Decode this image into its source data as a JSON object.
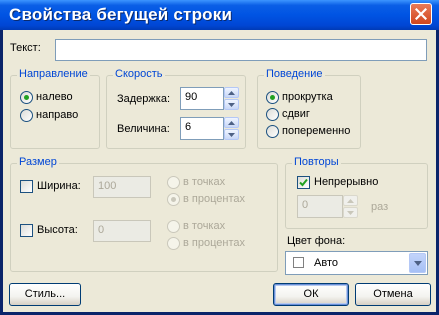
{
  "window": {
    "title": "Свойства бегущей строки"
  },
  "text_field": {
    "label": "Текст:",
    "value": ""
  },
  "direction": {
    "title": "Направление",
    "options": [
      {
        "label": "налево",
        "selected": true
      },
      {
        "label": "направо",
        "selected": false
      }
    ]
  },
  "speed": {
    "title": "Скорость",
    "delay": {
      "label": "Задержка:",
      "value": "90"
    },
    "amount": {
      "label": "Величина:",
      "value": "6"
    }
  },
  "behavior": {
    "title": "Поведение",
    "options": [
      {
        "label": "прокрутка",
        "selected": true
      },
      {
        "label": "сдвиг",
        "selected": false
      },
      {
        "label": "попеременно",
        "selected": false
      }
    ]
  },
  "size": {
    "title": "Размер",
    "width": {
      "label": "Ширина:",
      "checked": false,
      "value": "100",
      "unit_options": [
        "в точках",
        "в процентах"
      ],
      "selected_unit": 1
    },
    "height": {
      "label": "Высота:",
      "checked": false,
      "value": "0",
      "unit_options": [
        "в точках",
        "в процентах"
      ],
      "selected_unit": -1
    }
  },
  "repeat": {
    "title": "Повторы",
    "continuous": {
      "label": "Непрерывно",
      "checked": true
    },
    "count": {
      "value": "0",
      "suffix": "раз"
    }
  },
  "background": {
    "label": "Цвет фона:",
    "value": "Авто",
    "swatch_color": "#FFFFFF"
  },
  "buttons": {
    "style": "Стиль...",
    "ok": "ОК",
    "cancel": "Отмена"
  },
  "colors": {
    "title_bar": "#0054E3",
    "dialog_bg": "#ECE9D8",
    "group_title": "#0046D5",
    "close_button": "#D2461C"
  },
  "icons": [
    "close-icon",
    "spin-up-icon",
    "spin-down-icon",
    "checkmark-icon",
    "dropdown-arrow-icon"
  ]
}
